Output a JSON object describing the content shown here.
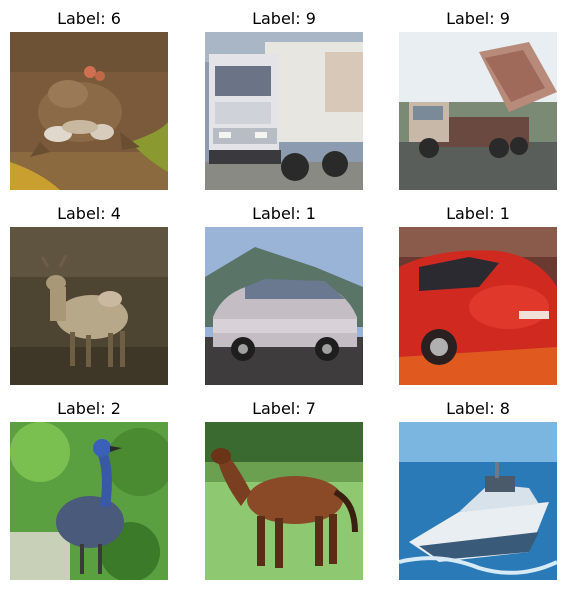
{
  "figure": {
    "panels": [
      {
        "title": "Label: 6",
        "content": "frog"
      },
      {
        "title": "Label: 9",
        "content": "truck"
      },
      {
        "title": "Label: 9",
        "content": "dump truck"
      },
      {
        "title": "Label: 4",
        "content": "deer"
      },
      {
        "title": "Label: 1",
        "content": "car"
      },
      {
        "title": "Label: 1",
        "content": "red car"
      },
      {
        "title": "Label: 2",
        "content": "bird"
      },
      {
        "title": "Label: 7",
        "content": "horse"
      },
      {
        "title": "Label: 8",
        "content": "boat"
      }
    ]
  }
}
